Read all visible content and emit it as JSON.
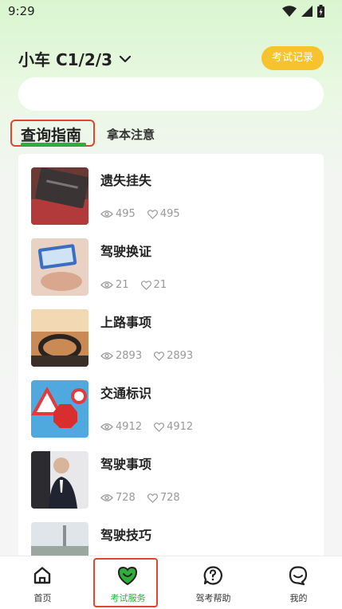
{
  "status_bar": {
    "time": "9:29"
  },
  "header": {
    "vehicle_type": "小车 C1/2/3",
    "record_button": "考试记录"
  },
  "search": {
    "placeholder": ""
  },
  "tabs": [
    {
      "label": "查询指南",
      "active": true
    },
    {
      "label": "拿本注意",
      "active": false
    }
  ],
  "items": [
    {
      "title": "遗失挂失",
      "views": "495",
      "likes": "495"
    },
    {
      "title": "驾驶换证",
      "views": "21",
      "likes": "21"
    },
    {
      "title": "上路事项",
      "views": "2893",
      "likes": "2893"
    },
    {
      "title": "交通标识",
      "views": "4912",
      "likes": "4912"
    },
    {
      "title": "驾驶事项",
      "views": "728",
      "likes": "728"
    },
    {
      "title": "驾驶技巧",
      "views": "",
      "likes": ""
    }
  ],
  "bottom_nav": [
    {
      "label": "首页",
      "icon": "home-icon",
      "active": false
    },
    {
      "label": "考试服务",
      "icon": "smile-heart-icon",
      "active": true
    },
    {
      "label": "驾考帮助",
      "icon": "question-bubble-icon",
      "active": false
    },
    {
      "label": "我的",
      "icon": "profile-face-icon",
      "active": false
    }
  ],
  "colors": {
    "accent_green": "#2fae3a",
    "record_yellow": "#f6c22d",
    "highlight_red": "#e2452c"
  }
}
